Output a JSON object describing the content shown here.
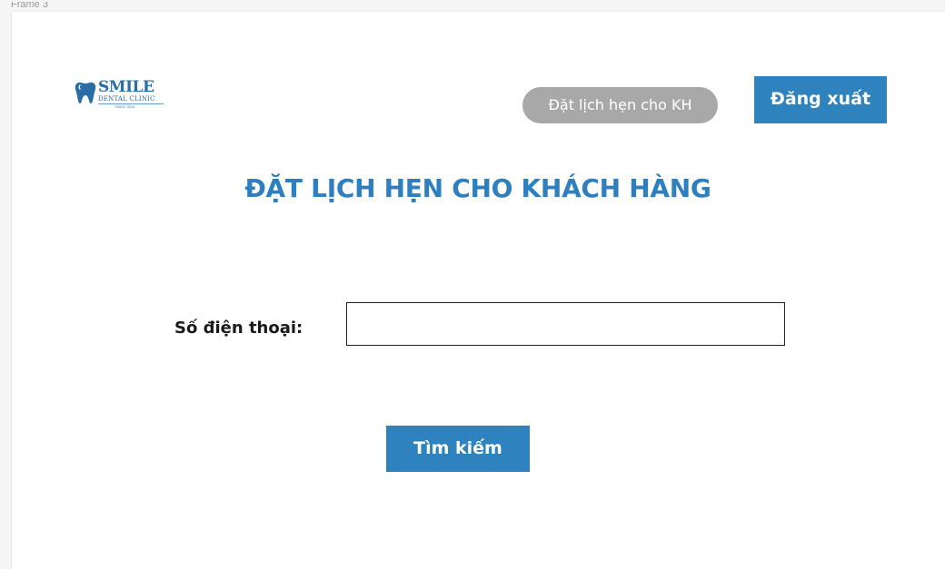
{
  "frame": {
    "label": "Frame 3"
  },
  "header": {
    "logo": {
      "name": "SMILE",
      "subtitle": "DENTAL CLINIC",
      "since": "SINCE 2015"
    },
    "nav_pill_label": "Đặt lịch hẹn cho KH",
    "logout_label": "Đăng xuất"
  },
  "main": {
    "title": "ĐẶT LỊCH HẸN CHO KHÁCH HÀNG",
    "phone": {
      "label": "Số điện thoại:",
      "value": "",
      "placeholder": ""
    },
    "search_label": "Tìm kiếm"
  },
  "colors": {
    "brand_blue": "#2e83be",
    "title_blue": "#2e7fbf",
    "pill_gray": "#a8a8a8"
  },
  "icons": {
    "logo": "tooth-icon"
  }
}
